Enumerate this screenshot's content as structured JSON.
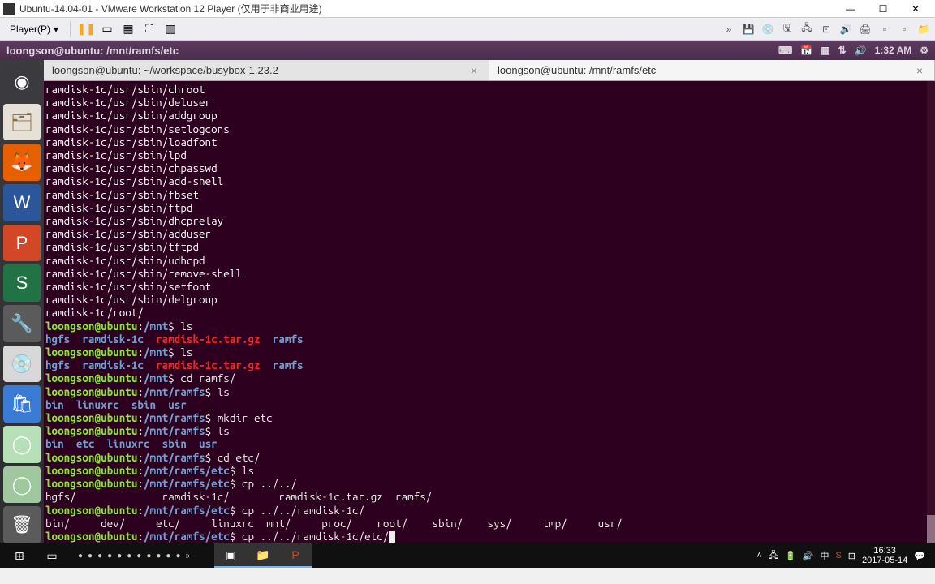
{
  "vmware": {
    "title": "Ubuntu-14.04-01 - VMware Workstation 12 Player (仅用于非商业用途)",
    "player_menu": "Player(P)"
  },
  "ubuntu_panel": {
    "title": "loongson@ubuntu: /mnt/ramfs/etc",
    "time": "1:32 AM"
  },
  "tabs": [
    {
      "label": "loongson@ubuntu: ~/workspace/busybox-1.23.2",
      "active": false
    },
    {
      "label": "loongson@ubuntu: /mnt/ramfs/etc",
      "active": true
    }
  ],
  "terminal": {
    "scroll_lines": [
      "ramdisk-1c/usr/sbin/chroot",
      "ramdisk-1c/usr/sbin/deluser",
      "ramdisk-1c/usr/sbin/addgroup",
      "ramdisk-1c/usr/sbin/setlogcons",
      "ramdisk-1c/usr/sbin/loadfont",
      "ramdisk-1c/usr/sbin/lpd",
      "ramdisk-1c/usr/sbin/chpasswd",
      "ramdisk-1c/usr/sbin/add-shell",
      "ramdisk-1c/usr/sbin/fbset",
      "ramdisk-1c/usr/sbin/ftpd",
      "ramdisk-1c/usr/sbin/dhcprelay",
      "ramdisk-1c/usr/sbin/adduser",
      "ramdisk-1c/usr/sbin/tftpd",
      "ramdisk-1c/usr/sbin/udhcpd",
      "ramdisk-1c/usr/sbin/remove-shell",
      "ramdisk-1c/usr/sbin/setfont",
      "ramdisk-1c/usr/sbin/delgroup",
      "ramdisk-1c/root/"
    ],
    "prompt_user": "loongson@ubuntu",
    "p_mnt": ":/mnt",
    "p_ramfs": ":/mnt/ramfs",
    "p_etc": ":/mnt/ramfs/etc",
    "cmd_ls": "$ ls",
    "cmd_cd_ramfs": "$ cd ramfs/",
    "cmd_mkdir": "$ mkdir etc",
    "cmd_cd_etc": "$ cd etc/",
    "cmd_cp1": "$ cp ../../",
    "cmd_cp2": "$ cp ../../ramdisk-1c/",
    "cmd_cp3": "$ cp ../../ramdisk-1c/etc/",
    "ls_mnt_hgfs": "hgfs",
    "ls_mnt_ramdisk": "ramdisk-1c",
    "ls_mnt_targz": "ramdisk-1c.tar.gz",
    "ls_mnt_ramfs": "ramfs",
    "ls_ramfs1_bin": "bin",
    "ls_ramfs1_linuxrc": "linuxrc",
    "ls_ramfs1_sbin": "sbin",
    "ls_ramfs1_usr": "usr",
    "ls_ramfs2_bin": "bin",
    "ls_ramfs2_etc": "etc",
    "ls_ramfs2_linuxrc": "linuxrc",
    "ls_ramfs2_sbin": "sbin",
    "ls_ramfs2_usr": "usr",
    "tab1_hgfs": "hgfs/",
    "tab1_ramdisk": "ramdisk-1c/",
    "tab1_targz": "ramdisk-1c.tar.gz",
    "tab1_ramfs": "ramfs/",
    "tab2_bin": "bin/",
    "tab2_dev": "dev/",
    "tab2_etc": "etc/",
    "tab2_linuxrc": "linuxrc",
    "tab2_mnt": "mnt/",
    "tab2_proc": "proc/",
    "tab2_root": "root/",
    "tab2_sbin": "sbin/",
    "tab2_sys": "sys/",
    "tab2_tmp": "tmp/",
    "tab2_usr": "usr/"
  },
  "launcher": {
    "items": [
      "search",
      "files",
      "firefox",
      "word",
      "ppt",
      "excel",
      "vm",
      "disk",
      "uk",
      "app1",
      "app2",
      "trash"
    ]
  },
  "taskbar": {
    "ime": "中",
    "time": "16:33",
    "date": "2017-05-14"
  }
}
